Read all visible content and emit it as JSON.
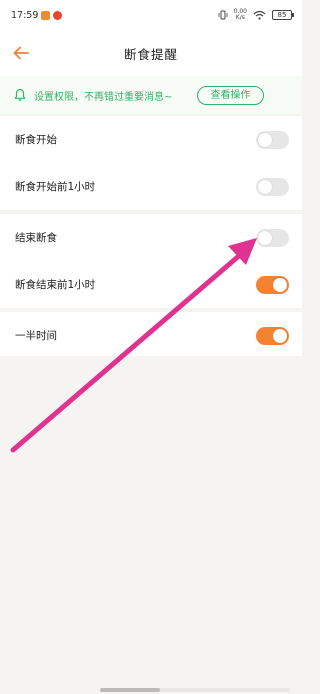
{
  "status_bar": {
    "time": "17:59",
    "network_top": "0.00",
    "network_bottom": "K/s",
    "battery": "85"
  },
  "header": {
    "title": "断食提醒"
  },
  "banner": {
    "text": "设置权限，不再错过重要消息~",
    "button_label": "查看操作"
  },
  "colors": {
    "accent_orange": "#f58132",
    "accent_green": "#37b06a",
    "annotation_arrow": "#e0338f"
  },
  "settings": {
    "fasting_start": {
      "label": "断食开始",
      "enabled": false
    },
    "fasting_start_1h": {
      "label": "断食开始前1小时",
      "enabled": false
    },
    "fasting_end": {
      "label": "结束断食",
      "enabled": false
    },
    "fasting_end_1h": {
      "label": "断食结束前1小时",
      "enabled": true
    },
    "halfway": {
      "label": "一半时间",
      "enabled": true
    }
  }
}
